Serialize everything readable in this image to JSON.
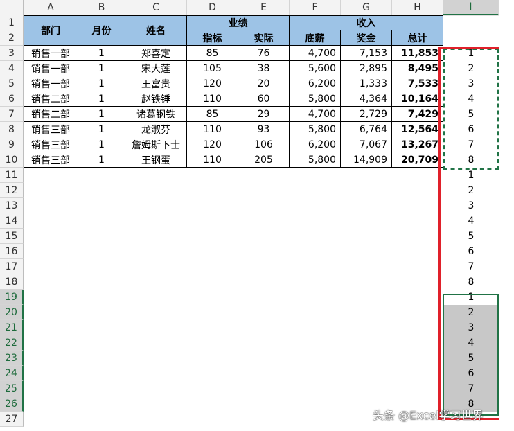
{
  "columns": [
    "A",
    "B",
    "C",
    "D",
    "E",
    "F",
    "G",
    "H",
    "I"
  ],
  "rows": [
    "1",
    "2",
    "3",
    "4",
    "5",
    "6",
    "7",
    "8",
    "9",
    "10",
    "11",
    "12",
    "13",
    "14",
    "15",
    "16",
    "17",
    "18",
    "19",
    "20",
    "21",
    "22",
    "23",
    "24",
    "25",
    "26",
    "27"
  ],
  "table": {
    "headers": {
      "dept": "部门",
      "month": "月份",
      "name": "姓名",
      "perf": "业绩",
      "income": "收入",
      "target": "指标",
      "actual": "实际",
      "base": "底薪",
      "bonus": "奖金",
      "total": "总计"
    },
    "rows": [
      {
        "dept": "销售一部",
        "month": "1",
        "name": "郑喜定",
        "target": "85",
        "actual": "76",
        "base": "4,700",
        "bonus": "7,153",
        "total": "11,853"
      },
      {
        "dept": "销售一部",
        "month": "1",
        "name": "宋大莲",
        "target": "105",
        "actual": "38",
        "base": "5,600",
        "bonus": "2,895",
        "total": "8,495"
      },
      {
        "dept": "销售一部",
        "month": "1",
        "name": "王富贵",
        "target": "120",
        "actual": "20",
        "base": "6,200",
        "bonus": "1,333",
        "total": "7,533"
      },
      {
        "dept": "销售二部",
        "month": "1",
        "name": "赵铁锤",
        "target": "110",
        "actual": "60",
        "base": "5,800",
        "bonus": "4,364",
        "total": "10,164"
      },
      {
        "dept": "销售二部",
        "month": "1",
        "name": "诸葛钢铁",
        "target": "85",
        "actual": "29",
        "base": "4,700",
        "bonus": "2,729",
        "total": "7,429"
      },
      {
        "dept": "销售三部",
        "month": "1",
        "name": "龙淑芬",
        "target": "110",
        "actual": "93",
        "base": "5,800",
        "bonus": "6,764",
        "total": "12,564"
      },
      {
        "dept": "销售三部",
        "month": "1",
        "name": "詹姆斯下士",
        "target": "120",
        "actual": "106",
        "base": "6,200",
        "bonus": "7,067",
        "total": "13,267"
      },
      {
        "dept": "销售三部",
        "month": "1",
        "name": "王钢蛋",
        "target": "110",
        "actual": "205",
        "base": "5,800",
        "bonus": "14,909",
        "total": "20,709"
      }
    ]
  },
  "column_i_values": [
    "1",
    "2",
    "3",
    "4",
    "5",
    "6",
    "7",
    "8",
    "1",
    "2",
    "3",
    "4",
    "5",
    "6",
    "7",
    "8",
    "1",
    "2",
    "3",
    "4",
    "5",
    "6",
    "7",
    "8"
  ],
  "watermark": "头条 @Excel学习世界",
  "colors": {
    "header_fill": "#9dc3e6",
    "selection": "#217346",
    "highlight_box": "#e0202a"
  }
}
